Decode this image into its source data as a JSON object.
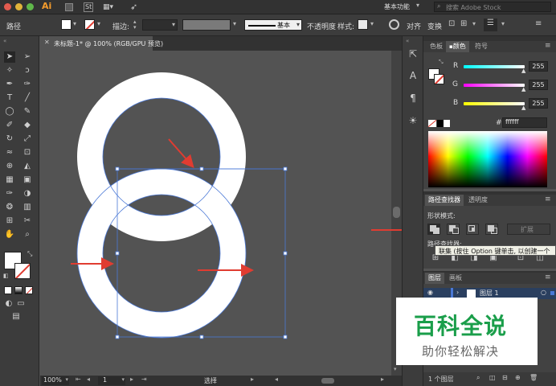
{
  "app": {
    "logo": "Ai",
    "menu_icon_st": "St",
    "workspace": "基本功能",
    "search_placeholder": "搜索 Adobe Stock"
  },
  "control_bar": {
    "object_type": "路径",
    "stroke_label": "描边:",
    "stroke_profile": "基本",
    "opacity_label": "不透明度",
    "style_label": "样式:",
    "align_label": "对齐",
    "transform_label": "变换"
  },
  "document": {
    "tab_title": "未标题-1* @ 100% (RGB/GPU 预览)"
  },
  "status": {
    "zoom": "100%",
    "artboard": "1",
    "tool_name": "选择"
  },
  "color_panel": {
    "tabs": [
      "色板",
      "颜色",
      "符号"
    ],
    "active_tab": "颜色",
    "r_label": "R",
    "g_label": "G",
    "b_label": "B",
    "r": "255",
    "g": "255",
    "b": "255",
    "hash": "#",
    "hex": "ffffff"
  },
  "pathfinder_panel": {
    "tabs": [
      "路径查找器",
      "透明度"
    ],
    "active_tab": "路径查找器",
    "shape_modes_label": "形状模式:",
    "expand_label": "扩展",
    "pathfinders_label": "路径查找器:",
    "tooltip": "联集 (按住 Option 键单击, 以创建一个"
  },
  "layers_panel": {
    "tabs": [
      "图层",
      "画板"
    ],
    "active_tab": "图层",
    "layer_name": "图层 1",
    "footer": "1 个图层"
  },
  "watermark": {
    "title": "百科全说",
    "subtitle": "助你轻松解决"
  },
  "colors": {
    "accent_red": "#e03c31",
    "selection_blue": "#4a78d6",
    "watermark_green": "#1a9e4a"
  }
}
